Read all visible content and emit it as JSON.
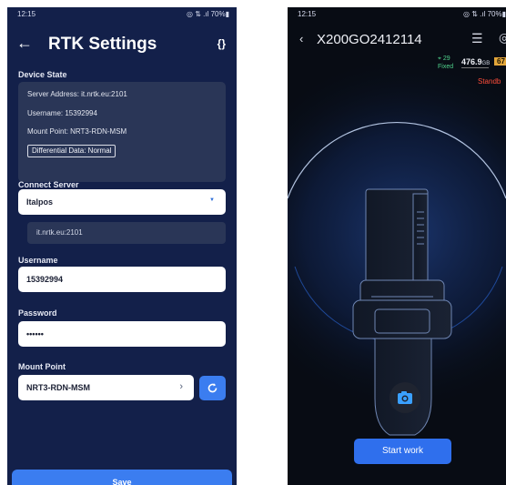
{
  "left": {
    "status_bar": {
      "time": "12:15",
      "right": "◎ ⇅ .ıl 70%▮"
    },
    "header": {
      "back": "←",
      "title": "RTK Settings",
      "menu": "{}"
    },
    "device_state": {
      "label": "Device State",
      "server_address": "Server Address: it.nrtk.eu:2101",
      "username": "Username: 15392994",
      "mount_point": "Mount Point: NRT3-RDN-MSM",
      "differential": "Differential Data: Normal"
    },
    "connect_server": {
      "label": "Connect Server",
      "value": "Italpos",
      "sub_value": "it.nrtk.eu:2101"
    },
    "username": {
      "label": "Username",
      "value": "15392994"
    },
    "password": {
      "label": "Password",
      "value": "••••••"
    },
    "mount_point": {
      "label": "Mount Point",
      "value": "NRT3-RDN-MSM",
      "chevron": "›"
    },
    "save_label": "Save"
  },
  "right": {
    "status_bar": {
      "time": "12:15",
      "right": "◎ ⇅ .ıl 70%▮"
    },
    "header": {
      "back": "‹",
      "device": "X200GO2412114",
      "menu": "☰",
      "gear": "◎"
    },
    "gnss": {
      "satellites": "29",
      "fix": "Fixed",
      "memory": "476.9",
      "memory_unit": "GB",
      "battery": "67"
    },
    "status": "Standb",
    "start_label": "Start work",
    "colors": {
      "accent": "#2f6fed",
      "fixed": "#4fd18b",
      "standby": "#ff4d3a",
      "battery": "#e3a63a"
    }
  }
}
